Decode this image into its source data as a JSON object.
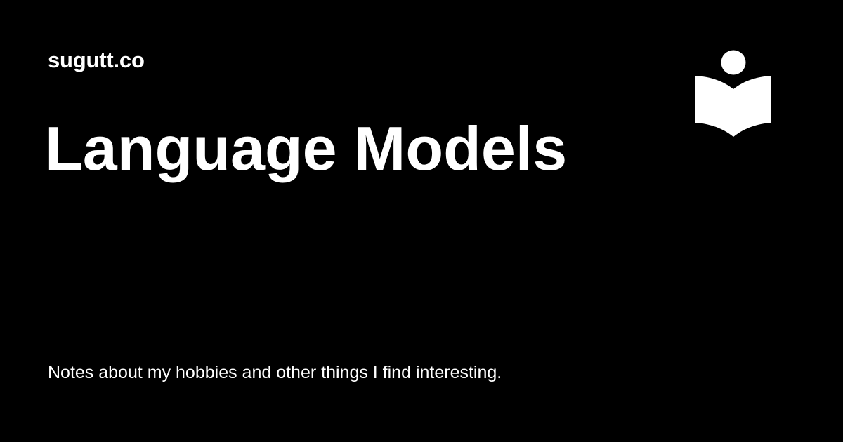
{
  "site": {
    "name": "sugutt.co",
    "logo_icon": "reader-book-icon"
  },
  "page": {
    "title": "Language Models",
    "tagline": "Notes about my hobbies and other things I find interesting."
  },
  "colors": {
    "background": "#000000",
    "text": "#ffffff"
  }
}
